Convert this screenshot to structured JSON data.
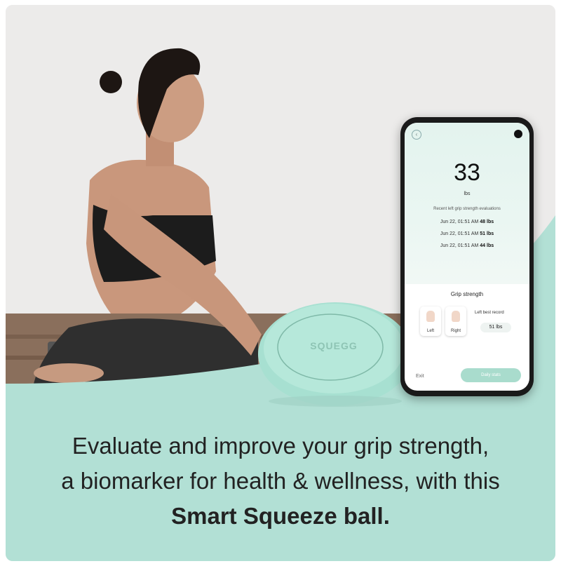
{
  "brand": {
    "logo_text": "SQUEGG"
  },
  "app": {
    "reading": "33",
    "unit": "lbs",
    "records_title": "Recent left grip strength evaluations",
    "records": [
      {
        "time": "Jun 22, 01:51 AM",
        "value": "48 lbs"
      },
      {
        "time": "Jun 22, 01:51 AM",
        "value": "51 lbs"
      },
      {
        "time": "Jun 22, 01:51 AM",
        "value": "44 lbs"
      }
    ],
    "grip_title": "Grip strength",
    "hand_left": "Left",
    "hand_right": "Right",
    "best_label": "Left best record",
    "best_value": "51 lbs",
    "exit_label": "Exit",
    "daily_button": "Daily stats"
  },
  "caption": {
    "line1": "Evaluate and improve your grip strength,",
    "line2": "a biomarker for health & wellness, with this",
    "line3": "Smart Squeeze ball."
  },
  "colors": {
    "mint": "#b2e0d5",
    "device": "#a7e0d1",
    "text": "#222222"
  }
}
